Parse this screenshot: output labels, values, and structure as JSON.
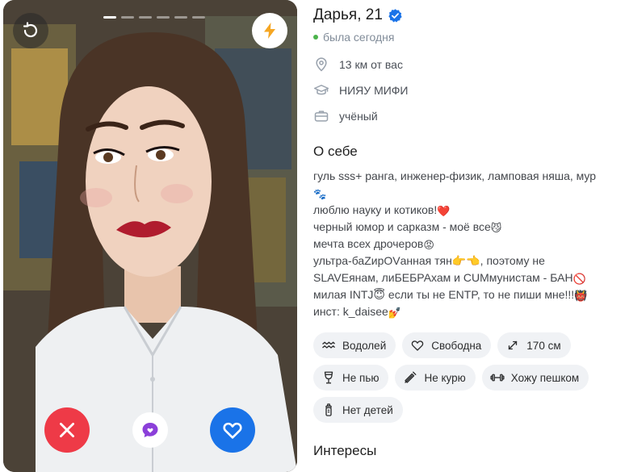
{
  "profile": {
    "name_age": "Дарья, 21",
    "status": "была сегодня",
    "distance": "13 км от вас",
    "university": "НИЯУ МИФИ",
    "occupation": "учёный"
  },
  "about": {
    "title": "О себе",
    "lines": [
      {
        "text": "гуль sss+ ранга, инженер-физик, ламповая няша, мур",
        "emoji": ""
      },
      {
        "text": "",
        "emoji": "🐾"
      },
      {
        "text": "люблю науку и котиков!",
        "emoji": "❤️"
      },
      {
        "text": "черный юмор и сарказм - моё все",
        "emoji": "😼"
      },
      {
        "text": "мечта всех дрочеров",
        "emoji": "😡"
      },
      {
        "text": "ультра-баZирOVанная тян👉👈, поэтому не",
        "emoji": ""
      },
      {
        "text": "SLAVEянам, лиБЕБРАхам и CUMмунистам - БАН",
        "emoji": "🚫"
      },
      {
        "text": "милая INTJ😇 если ты не ENTP, то не пиши мне!!!",
        "emoji": "👹"
      },
      {
        "text": "инст: k_daisee",
        "emoji": "💅"
      }
    ]
  },
  "chips": {
    "row1": [
      {
        "icon": "aquarius-icon",
        "label": "Водолей"
      },
      {
        "icon": "heart-outline-icon",
        "label": "Свободна"
      },
      {
        "icon": "height-icon",
        "label": "170 см"
      }
    ],
    "row2": [
      {
        "icon": "wine-glass-icon",
        "label": "Не пью"
      },
      {
        "icon": "no-smoking-icon",
        "label": "Не курю"
      },
      {
        "icon": "dumbbell-icon",
        "label": "Хожу пешком"
      }
    ],
    "row3": [
      {
        "icon": "baby-bottle-icon",
        "label": "Нет детей"
      }
    ]
  },
  "interests_title": "Интересы",
  "photo": {
    "total_photos": 6,
    "current_photo": 1
  },
  "colors": {
    "like": "#1a73e8",
    "dislike": "#ee3a47",
    "boost": "#f5a623",
    "online": "#4bb34b",
    "verified": "#1a73e8"
  }
}
